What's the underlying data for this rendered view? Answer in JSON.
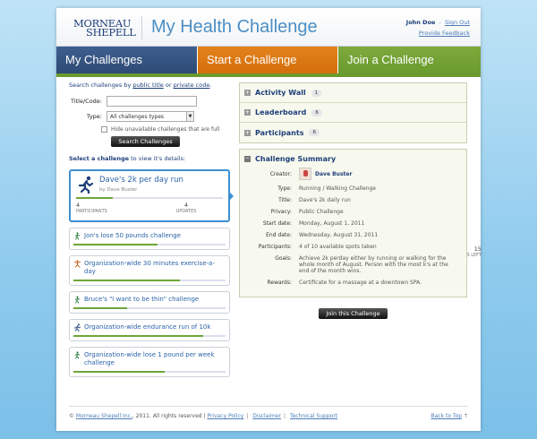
{
  "header": {
    "logo_line1": "MORNEAU",
    "logo_line2": "SHEPELL",
    "title": "My Health Challenge",
    "user_name": "John Doe",
    "sign_out": "Sign Out",
    "feedback": "Provide Feedback"
  },
  "tabs": {
    "my": "My Challenges",
    "start": "Start a Challenge",
    "join": "Join a Challenge"
  },
  "search": {
    "intro_prefix": "Search challenges by",
    "public_title": "public title",
    "or": "or",
    "private_code": "private code",
    "title_label": "Title/Code:",
    "title_value": "",
    "type_label": "Type:",
    "type_value": "All challenges types",
    "hide_full": "Hide unavailable challenges that are full",
    "button": "Search Challenges"
  },
  "select_note_bold": "Select a challenge",
  "select_note_rest": "to view it's details:",
  "featured": {
    "title": "Dave's 2k per day run",
    "by": "by Dave Buster",
    "progress": 0.25,
    "stats": [
      {
        "num": "4",
        "label": "PARTICIPANTS"
      },
      {
        "num": "4",
        "label": "UPDATES"
      },
      {
        "num": "15",
        "label": "DAYS LEFT"
      }
    ]
  },
  "challenges": [
    {
      "title": "Jon's lose 50 pounds challenge",
      "icon": "walker-icon",
      "progress": 0.55
    },
    {
      "title": "Organization-wide 30 minutes exercise-a-day",
      "icon": "exercise-icon",
      "progress": 0.7
    },
    {
      "title": "Bruce's \"I want to be thin\" challenge",
      "icon": "walker-icon",
      "progress": 0.35
    },
    {
      "title": "Organization-wide endurance run of 10k",
      "icon": "runner-icon",
      "progress": 0.85
    },
    {
      "title": "Organization-wide lose 1 pound per week challenge",
      "icon": "walker-icon",
      "progress": 0.6
    }
  ],
  "panels": {
    "activity_wall": {
      "label": "Activity Wall",
      "count": "1"
    },
    "leaderboard": {
      "label": "Leaderboard",
      "count": "6"
    },
    "participants": {
      "label": "Participants",
      "count": "6"
    }
  },
  "summary": {
    "title": "Challenge Summary",
    "creator_label": "Creator:",
    "creator_name": "Dave Buster",
    "rows": [
      {
        "k": "Type:",
        "v": "Running / Walking Challenge"
      },
      {
        "k": "Title:",
        "v": "Dave's 2k daily run"
      },
      {
        "k": "Privacy:",
        "v": "Public Challenge"
      },
      {
        "k": "Start date:",
        "v": "Monday, August 1, 2011"
      },
      {
        "k": "End date:",
        "v": "Wednesday, August 31, 2011"
      },
      {
        "k": "Participants:",
        "v": "4 of 10 available spots taken"
      },
      {
        "k": "Goals:",
        "v": "Achieve 2k perday either by running or walking for the whole month of August. Person with the most k's at the end of the month wins."
      },
      {
        "k": "Rewards:",
        "v": "Certificate for a massage at a downtown SPA."
      }
    ],
    "join_button": "Join this Challenge"
  },
  "footer": {
    "copyright_prefix": "©",
    "company": "Morneau Shepell Inc.",
    "copyright_suffix": ", 2011. All rights reserved |",
    "privacy": "Privacy Policy",
    "disclaimer": "Disclaimer",
    "support": "Technical Support",
    "back_top": "Back to Top",
    "back_top_glyph": "⇡"
  },
  "colors": {
    "tab_my": "#3e5f8f",
    "tab_start": "#e3831c",
    "tab_join": "#7eaa3d",
    "link": "#2a63a7",
    "progress": "#6ea639"
  }
}
